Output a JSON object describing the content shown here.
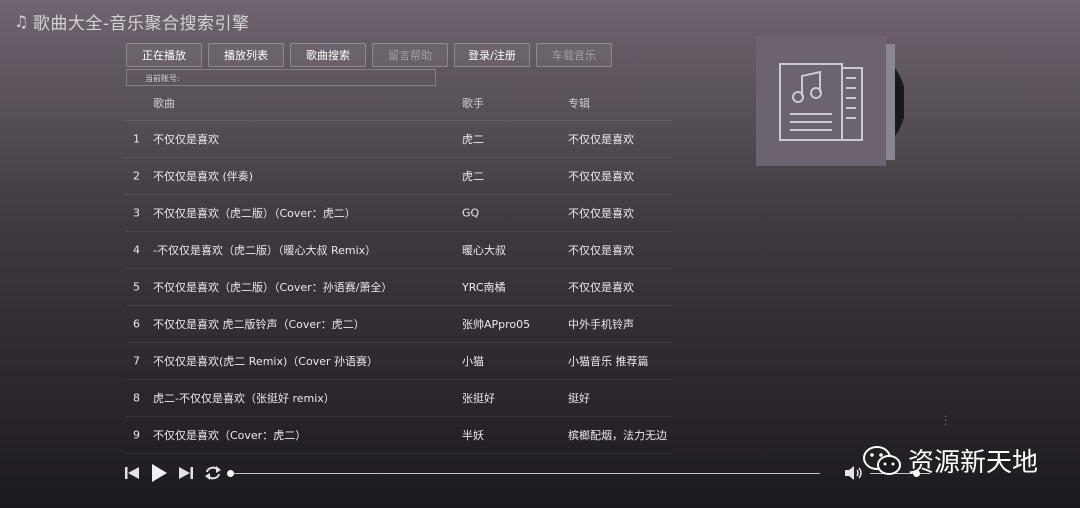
{
  "app": {
    "title": "歌曲大全-音乐聚合搜索引擎",
    "title_icon": "music-note-icon"
  },
  "tabs": [
    {
      "label": "正在播放",
      "active": true
    },
    {
      "label": "播放列表",
      "active": true
    },
    {
      "label": "歌曲搜索",
      "active": true
    },
    {
      "label": "留言帮助",
      "active": false
    },
    {
      "label": "登录/注册",
      "active": true
    },
    {
      "label": "车载音乐",
      "active": false
    }
  ],
  "account": {
    "label": "当前账号:"
  },
  "table": {
    "headers": {
      "song": "歌曲",
      "artist": "歌手",
      "album": "专辑"
    },
    "rows": [
      {
        "num": "1",
        "song": "不仅仅是喜欢",
        "artist": "虎二",
        "album": "不仅仅是喜欢"
      },
      {
        "num": "2",
        "song": "不仅仅是喜欢 (伴奏)",
        "artist": "虎二",
        "album": "不仅仅是喜欢"
      },
      {
        "num": "3",
        "song": "不仅仅是喜欢（虎二版）（Cover：虎二）",
        "artist": "GQ",
        "album": "不仅仅是喜欢"
      },
      {
        "num": "4",
        "song": "-不仅仅是喜欢（虎二版）（暖心大叔 Remix）",
        "artist": "暖心大叔",
        "album": "不仅仅是喜欢"
      },
      {
        "num": "5",
        "song": "不仅仅是喜欢（虎二版）（Cover：孙语赛/萧全）",
        "artist": "YRC南橘",
        "album": "不仅仅是喜欢"
      },
      {
        "num": "6",
        "song": "不仅仅是喜欢 虎二版铃声（Cover：虎二）",
        "artist": "张帅APpro05",
        "album": "中外手机铃声"
      },
      {
        "num": "7",
        "song": "不仅仅是喜欢(虎二 Remix)（Cover 孙语赛）",
        "artist": "小猫",
        "album": "小猫音乐 推荐篇"
      },
      {
        "num": "8",
        "song": "虎二-不仅仅是喜欢（张挺好 remix）",
        "artist": "张挺好",
        "album": "挺好"
      },
      {
        "num": "9",
        "song": "不仅仅是喜欢（Cover：虎二）",
        "artist": "半妖",
        "album": "槟榔配烟，法力无边"
      }
    ]
  },
  "player": {
    "progress": 0,
    "volume": 0.78,
    "icons": [
      "prev-icon",
      "play-icon",
      "next-icon",
      "repeat-icon",
      "volume-icon"
    ]
  },
  "watermark": {
    "text": "资源新天地"
  },
  "colors": {
    "bg_top": "#6f6470",
    "bg_bottom": "#1d1a1f",
    "cover_bg": "#6d626f"
  }
}
